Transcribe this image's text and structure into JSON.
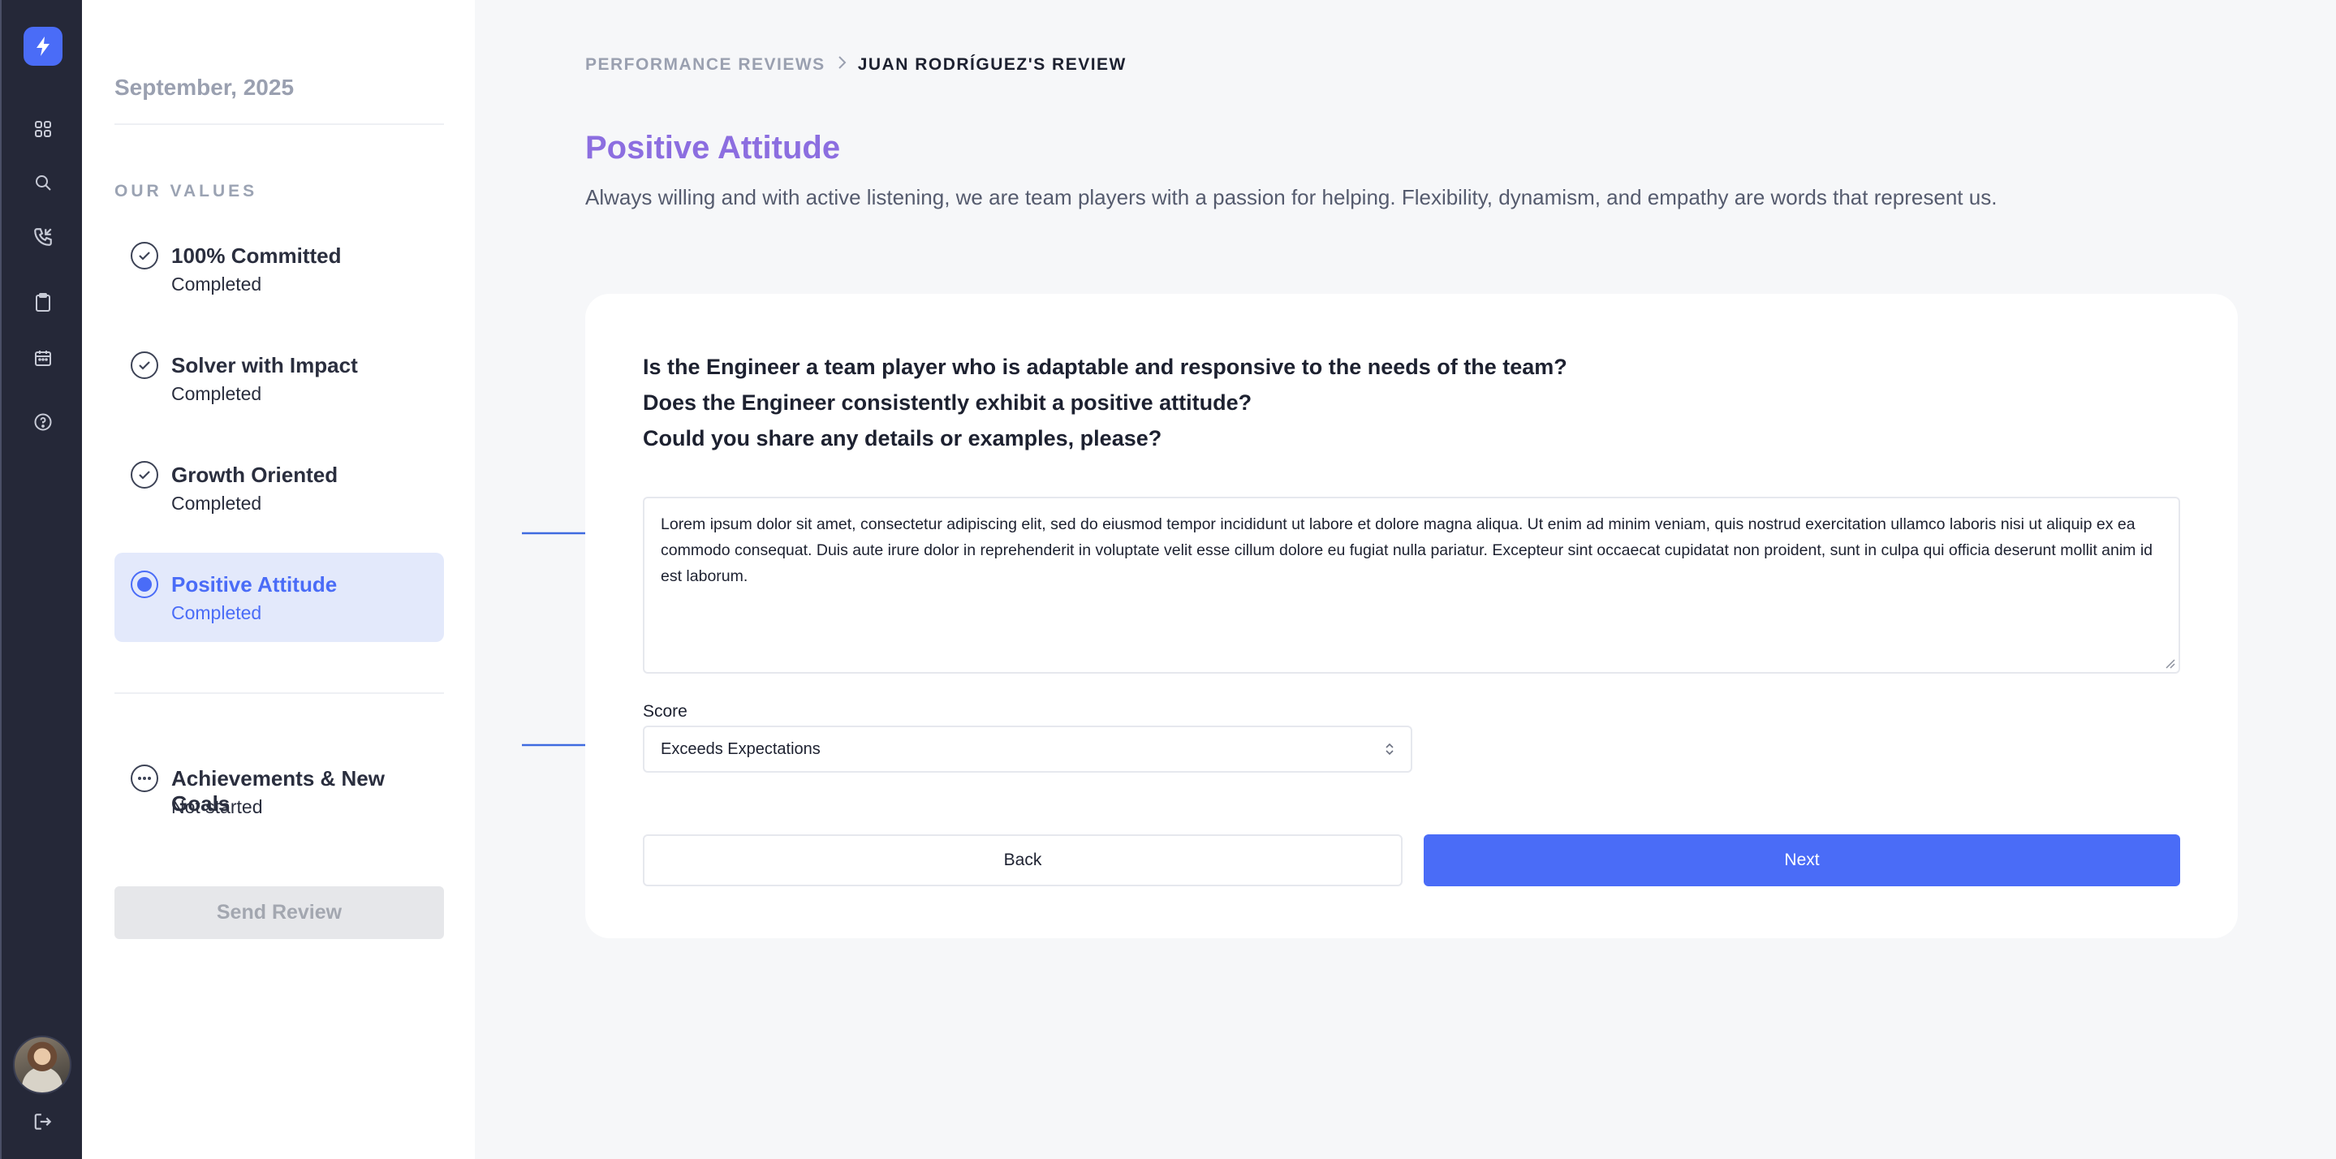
{
  "sidebar": {
    "icons": [
      "grid-icon",
      "search-icon",
      "phone-call-icon",
      "clipboard-icon",
      "calendar-icon",
      "help-icon"
    ],
    "bottom_icon": "logout-icon"
  },
  "steps_panel": {
    "date": "September, 2025",
    "values_title": "OUR VALUES",
    "steps": [
      {
        "title": "100% Committed",
        "status": "Completed",
        "state": "done"
      },
      {
        "title": "Solver with Impact",
        "status": "Completed",
        "state": "done"
      },
      {
        "title": "Growth Oriented",
        "status": "Completed",
        "state": "done"
      },
      {
        "title": "Positive Attitude",
        "status": "Completed",
        "state": "active"
      }
    ],
    "extra_step": {
      "title": "Achievements & New Goals",
      "status": "Not started",
      "state": "pending"
    },
    "send_button": "Send Review"
  },
  "breadcrumb": {
    "parent": "PERFORMANCE REVIEWS",
    "current": "JUAN RODRÍGUEZ'S REVIEW"
  },
  "page": {
    "title": "Positive Attitude",
    "description": "Always willing and with active listening, we are team players with a passion for helping. Flexibility, dynamism, and empathy are words that represent us."
  },
  "form": {
    "questions": [
      "Is the Engineer a team player who is adaptable and responsive to the needs of the team?",
      "Does the Engineer consistently exhibit a positive attitude?",
      "Could you share any details or examples, please?"
    ],
    "answer": "Lorem ipsum dolor sit amet, consectetur adipiscing elit, sed do eiusmod tempor incididunt ut labore et dolore magna aliqua. Ut enim ad minim veniam, quis nostrud exercitation ullamco laboris nisi ut aliquip ex ea commodo consequat. Duis aute irure dolor in reprehenderit in voluptate velit esse cillum dolore eu fugiat nulla pariatur. Excepteur sint occaecat cupidatat non proident, sunt in culpa qui officia deserunt mollit anim id est laborum.",
    "score_label": "Score",
    "score_value": "Exceeds Expectations",
    "back_label": "Back",
    "next_label": "Next"
  },
  "colors": {
    "accent": "#4a6cf7",
    "title": "#8c6ee0",
    "rail": "#252838"
  }
}
